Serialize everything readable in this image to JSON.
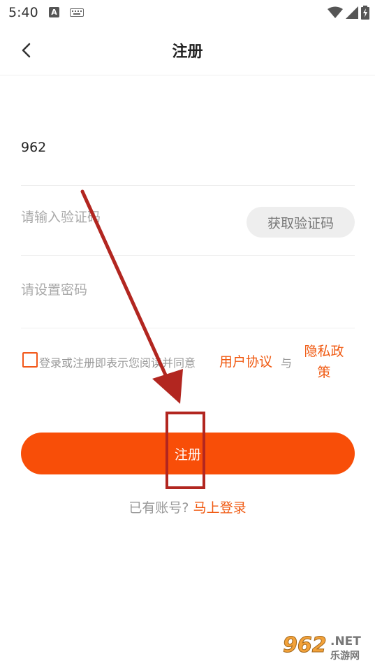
{
  "status_bar": {
    "time": "5:40",
    "notification_badge": "A"
  },
  "header": {
    "title": "注册"
  },
  "form": {
    "phone_value": "962",
    "code_placeholder": "请输入验证码",
    "get_code_label": "获取验证码",
    "password_placeholder": "请设置密码"
  },
  "agreement": {
    "text": "登录或注册即表示您阅读并同意",
    "user_agreement": "用户协议",
    "and": "与",
    "privacy_policy": "隐私政策"
  },
  "register_button": "注册",
  "login": {
    "prefix": "已有账号?",
    "link": "马上登录"
  },
  "watermark": {
    "number": "962",
    "domain": ".NET",
    "name": "乐游网"
  },
  "colors": {
    "accent": "#f84e08",
    "link": "#f05a12",
    "annotation": "#b22620"
  }
}
